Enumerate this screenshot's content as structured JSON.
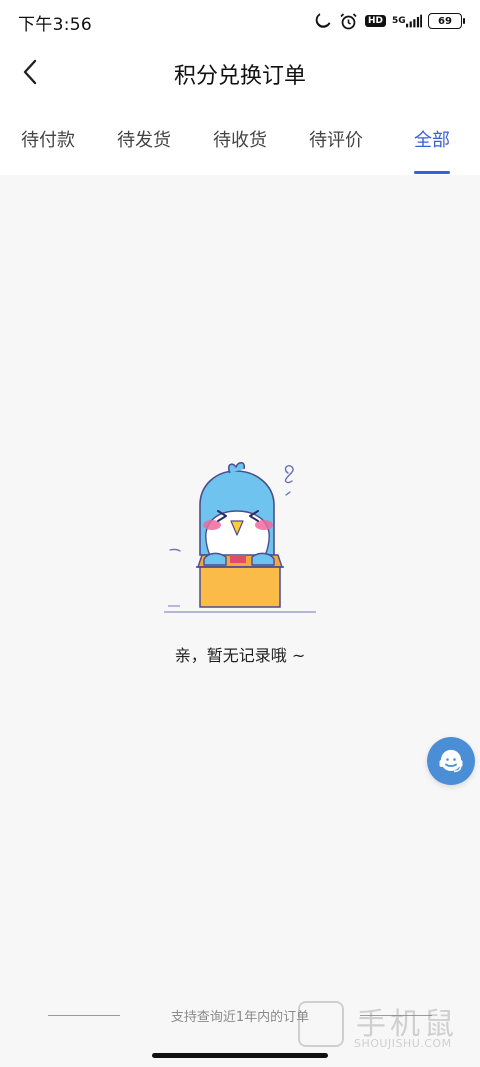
{
  "status_bar": {
    "time": "下午3:56",
    "icons": [
      "moon-icon",
      "alarm-icon",
      "hd-icon",
      "5g-signal-icon",
      "battery-icon"
    ],
    "hd_label": "HD",
    "network_label": "5G",
    "battery_level": "69"
  },
  "header": {
    "title": "积分兑换订单",
    "back_icon": "back-arrow-icon"
  },
  "tabs": [
    {
      "label": "待付款",
      "active": false
    },
    {
      "label": "待发货",
      "active": false
    },
    {
      "label": "待收货",
      "active": false
    },
    {
      "label": "待评价",
      "active": false
    },
    {
      "label": "全部",
      "active": true
    }
  ],
  "empty_state": {
    "message": "亲，暂无记录哦 ~",
    "illustration": "bird-in-box-illustration"
  },
  "support": {
    "icon": "customer-service-headset-icon"
  },
  "footer": {
    "note": "支持查询近1年内的订单"
  },
  "watermark": {
    "main": "手机鼠",
    "sub": "SHOUJISHU.COM"
  },
  "colors": {
    "accent": "#3a5fd9",
    "support_button": "#4a8fd6",
    "background": "#f7f7f7"
  }
}
